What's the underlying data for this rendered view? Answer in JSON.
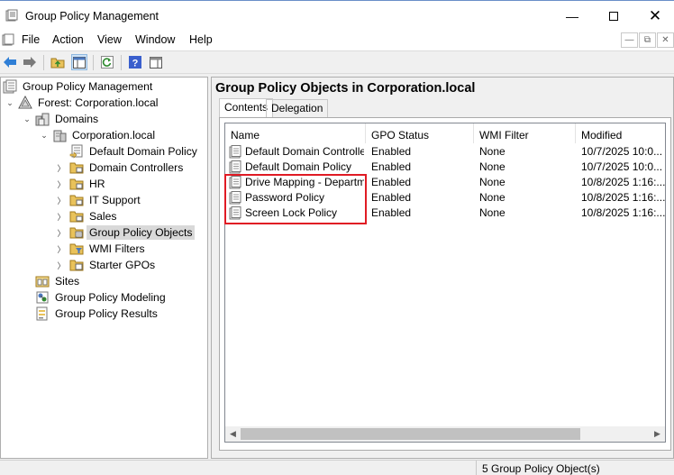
{
  "window": {
    "title": "Group Policy Management"
  },
  "menu": [
    "File",
    "Action",
    "View",
    "Window",
    "Help"
  ],
  "tree": {
    "root": "Group Policy Management",
    "forest": "Forest: Corporation.local",
    "domains": "Domains",
    "domain": "Corporation.local",
    "children": [
      "Default Domain Policy",
      "Domain Controllers",
      "HR",
      "IT Support",
      "Sales",
      "Group Policy Objects",
      "WMI Filters",
      "Starter GPOs"
    ],
    "sites": "Sites",
    "modeling": "Group Policy Modeling",
    "results": "Group Policy Results"
  },
  "right": {
    "title": "Group Policy Objects in Corporation.local",
    "tabs": [
      "Contents",
      "Delegation"
    ],
    "columns": [
      "Name",
      "GPO Status",
      "WMI Filter",
      "Modified"
    ],
    "rows": [
      [
        "Default Domain Controller...",
        "Enabled",
        "None",
        "10/7/2025 10:0..."
      ],
      [
        "Default Domain Policy",
        "Enabled",
        "None",
        "10/7/2025 10:0..."
      ],
      [
        "Drive Mapping - Departme...",
        "Enabled",
        "None",
        "10/8/2025 1:16:..."
      ],
      [
        "Password Policy",
        "Enabled",
        "None",
        "10/8/2025 1:16:..."
      ],
      [
        "Screen Lock Policy",
        "Enabled",
        "None",
        "10/8/2025 1:16:..."
      ]
    ]
  },
  "status": "5 Group Policy Object(s)",
  "colors": {
    "highlight": "#e01b24",
    "selection": "#d9d9d9"
  }
}
